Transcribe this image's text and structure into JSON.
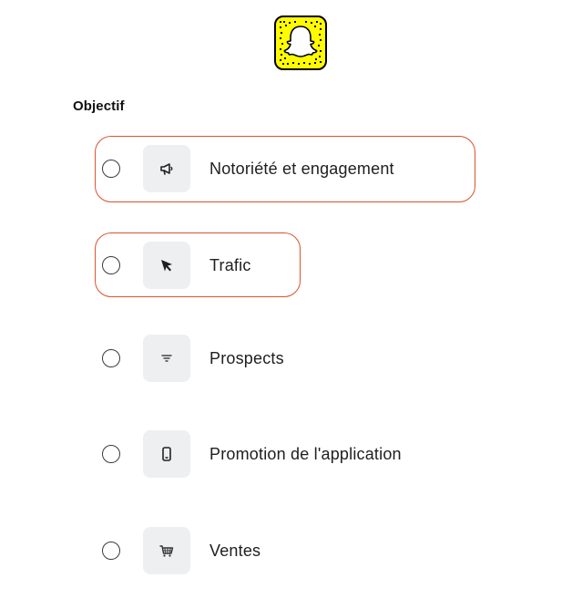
{
  "logo": {
    "icon": "snapchat-snapcode-icon",
    "color": "#fffc00"
  },
  "section": {
    "label": "Objectif"
  },
  "options": [
    {
      "label": "Notoriété et engagement",
      "icon": "megaphone-icon",
      "selected": false,
      "highlighted": true
    },
    {
      "label": "Trafic",
      "icon": "cursor-arrow-icon",
      "selected": false,
      "highlighted": true
    },
    {
      "label": "Prospects",
      "icon": "filter-icon",
      "selected": false,
      "highlighted": false
    },
    {
      "label": "Promotion de l'application",
      "icon": "mobile-phone-icon",
      "selected": false,
      "highlighted": false
    },
    {
      "label": "Ventes",
      "icon": "shopping-cart-icon",
      "selected": false,
      "highlighted": false
    }
  ],
  "colors": {
    "highlight": "#d8542e",
    "icon_bg": "#eeeff0"
  }
}
